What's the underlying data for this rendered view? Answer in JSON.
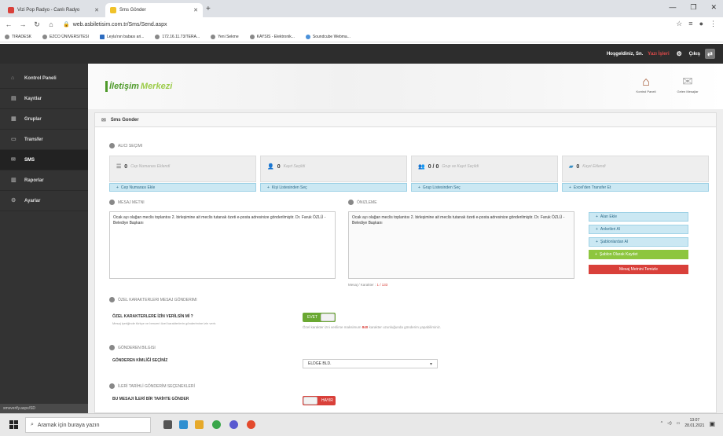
{
  "browser": {
    "tabs": [
      {
        "title": "Vizi Pop Radyo - Canlı Radyo",
        "active": false
      },
      {
        "title": "Sms Gönder",
        "active": true
      }
    ],
    "url": "web.asbiletisim.com.tr/Sms/Send.aspx",
    "bookmarks": [
      "TIRADESK",
      "EZCO ÜNIVERSITESI",
      "Leyla'nın babası ari...",
      "172.16.11.73/TERA...",
      "Yeni Sekme",
      "KAYSIS - Elektronik...",
      "Soundcube Webma..."
    ]
  },
  "header": {
    "greeting": "Hoşgeldiniz, Sn.",
    "user": "Yazı İşleri",
    "logout_label": "Çıkış"
  },
  "sidebar": {
    "items": [
      {
        "label": "Kontrol Paneli",
        "icon": "dashboard-icon",
        "active": false
      },
      {
        "label": "Kayıtlar",
        "icon": "records-icon",
        "active": false
      },
      {
        "label": "Gruplar",
        "icon": "groups-icon",
        "active": false
      },
      {
        "label": "Transfer",
        "icon": "transfer-icon",
        "active": false
      },
      {
        "label": "SMS",
        "icon": "sms-icon",
        "active": true
      },
      {
        "label": "Raporlar",
        "icon": "reports-icon",
        "active": false
      },
      {
        "label": "Ayarlar",
        "icon": "settings-icon",
        "active": false
      }
    ],
    "footer": "smsverify.aspx/SD"
  },
  "logo": {
    "part1": "İletişim",
    "part2": "Merkezi"
  },
  "topnav": {
    "control_panel": "Kontrol Paneli",
    "inbox": "Gelen Mesajlar"
  },
  "panel": {
    "title": "Sms Gonder"
  },
  "recipients": {
    "title": "ALICI SEÇIMI",
    "boxes": [
      {
        "count": "0",
        "label": "Cep Numarası Eklendi",
        "button": "Cep Numarası Ekle"
      },
      {
        "count": "0",
        "label": "Kayıt Seçildi",
        "button": "Kişi Listesinden Seç"
      },
      {
        "count": "0 / 0",
        "label": "Grup ve Kayıt Seçildi",
        "button": "Grup Listesinden Seç"
      },
      {
        "count": "0",
        "label": "Kayıt Eklendi",
        "button": "Excel'den Transfer Et"
      }
    ]
  },
  "message": {
    "title": "MESAJ METNI",
    "text": "Ocak ayı olağan meclis toplantısı 2. birleşimine ait meclis tutanak özeti e-posta adresinize gönderilmiştir. Dr. Faruk ÖZLÜ - Belediye Başkanı",
    "counter_label": "Mesaj / Karakter :",
    "counter_value": "1 / 133"
  },
  "preview": {
    "title": "ÖNIZLEME",
    "text": "Ocak ayı olağan meclis toplantısı 2. birleşimine ait meclis tutanak özeti e-posta adresinize gönderilmiştir. Dr. Faruk ÖZLÜ - Belediye Başkanı"
  },
  "actions": {
    "add_field": "Alan Ekle",
    "add_link": "Anketleri Al",
    "add_template": "Şablonlardan Al",
    "save_template": "Şablon Olarak Kaydet",
    "clear_message": "Mesaj Metnini Temizle"
  },
  "special_chars": {
    "title": "ÖZEL KARAKTERLERI MESAJ GÖNDERIMI",
    "question": "ÖZEL KARAKTERLERE İZİN VERİLSİN Mİ ?",
    "note": "Mesaj içeriğinde türkçe ve benzeri özel karakterlerin gönderimine izin verir.",
    "toggle": "EVET",
    "info_before": "Özel karakter izni verilirse maksimum",
    "info_number": "840",
    "info_after": "karakter uzunluğunda gönderim yapabilirsiniz."
  },
  "sender": {
    "title": "GÖNDEREN BILGISI",
    "label": "GÖNDEREN KİMLİĞİ SEÇİNİZ",
    "selected": "ELDGE BLD."
  },
  "schedule": {
    "title": "İLERİ TARİHLİ GÖNDERİM SEÇENEKLERİ",
    "label": "BU MESAJI İLERİ BİR TARİHTE GÖNDER",
    "toggle": "HAYIR"
  },
  "taskbar": {
    "search_placeholder": "Aramak için buraya yazın",
    "time": "13:07",
    "date": "28.01.2021"
  }
}
